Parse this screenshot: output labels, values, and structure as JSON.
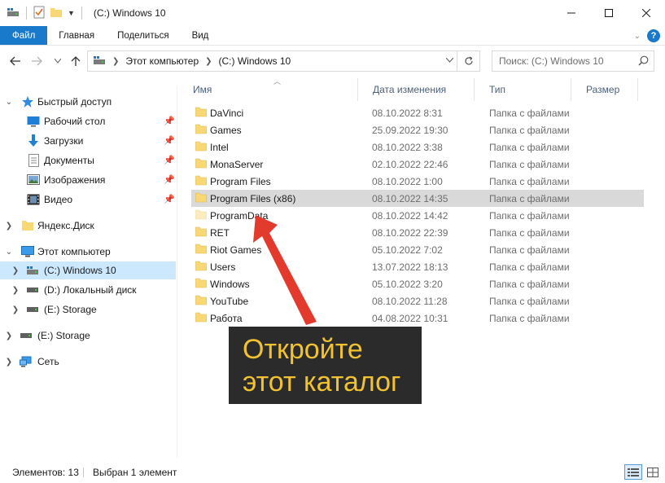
{
  "window": {
    "title": "(C:) Windows 10"
  },
  "ribbon": {
    "tabs": [
      {
        "label": "Файл"
      },
      {
        "label": "Главная"
      },
      {
        "label": "Поделиться"
      },
      {
        "label": "Вид"
      }
    ],
    "help": "?"
  },
  "address": {
    "segments": [
      "Этот компьютер",
      "(C:) Windows 10"
    ]
  },
  "search": {
    "placeholder": "Поиск: (C:) Windows 10"
  },
  "sidebar": {
    "quick_access": "Быстрый доступ",
    "quick_items": [
      "Рабочий стол",
      "Загрузки",
      "Документы",
      "Изображения",
      "Видео"
    ],
    "yandex": "Яндекс.Диск",
    "this_pc": "Этот компьютер",
    "drives": [
      "(C:) Windows 10",
      "(D:) Локальный диск",
      "(E:) Storage"
    ],
    "storage2": "(E:) Storage",
    "network": "Сеть"
  },
  "columns": {
    "name": "Имя",
    "date": "Дата изменения",
    "type": "Тип",
    "size": "Размер"
  },
  "files": [
    {
      "name": "DaVinci",
      "date": "08.10.2022 8:31",
      "type": "Папка с файлами"
    },
    {
      "name": "Games",
      "date": "25.09.2022 19:30",
      "type": "Папка с файлами"
    },
    {
      "name": "Intel",
      "date": "08.10.2022 3:38",
      "type": "Папка с файлами"
    },
    {
      "name": "MonaServer",
      "date": "02.10.2022 22:46",
      "type": "Папка с файлами"
    },
    {
      "name": "Program Files",
      "date": "08.10.2022 1:00",
      "type": "Папка с файлами"
    },
    {
      "name": "Program Files (x86)",
      "date": "08.10.2022 14:35",
      "type": "Папка с файлами"
    },
    {
      "name": "ProgramData",
      "date": "08.10.2022 14:42",
      "type": "Папка с файлами"
    },
    {
      "name": "RET",
      "date": "08.10.2022 22:39",
      "type": "Папка с файлами"
    },
    {
      "name": "Riot Games",
      "date": "05.10.2022 7:02",
      "type": "Папка с файлами"
    },
    {
      "name": "Users",
      "date": "13.07.2022 18:13",
      "type": "Папка с файлами"
    },
    {
      "name": "Windows",
      "date": "05.10.2022 3:20",
      "type": "Папка с файлами"
    },
    {
      "name": "YouTube",
      "date": "08.10.2022 11:28",
      "type": "Папка с файлами"
    },
    {
      "name": "Работа",
      "date": "04.08.2022 10:31",
      "type": "Папка с файлами"
    }
  ],
  "callout": {
    "line1": "Откройте",
    "line2": "этот каталог"
  },
  "status": {
    "count": "Элементов: 13",
    "selected": "Выбран 1 элемент"
  },
  "colors": {
    "accent": "#1979ca",
    "folder": "#f8d775",
    "selected_nav": "#cce8ff",
    "highlight_row": "#d9d9d9",
    "arrow": "#e23b2e",
    "callout_text": "#f2c230",
    "callout_bg": "#2b2b2b"
  }
}
